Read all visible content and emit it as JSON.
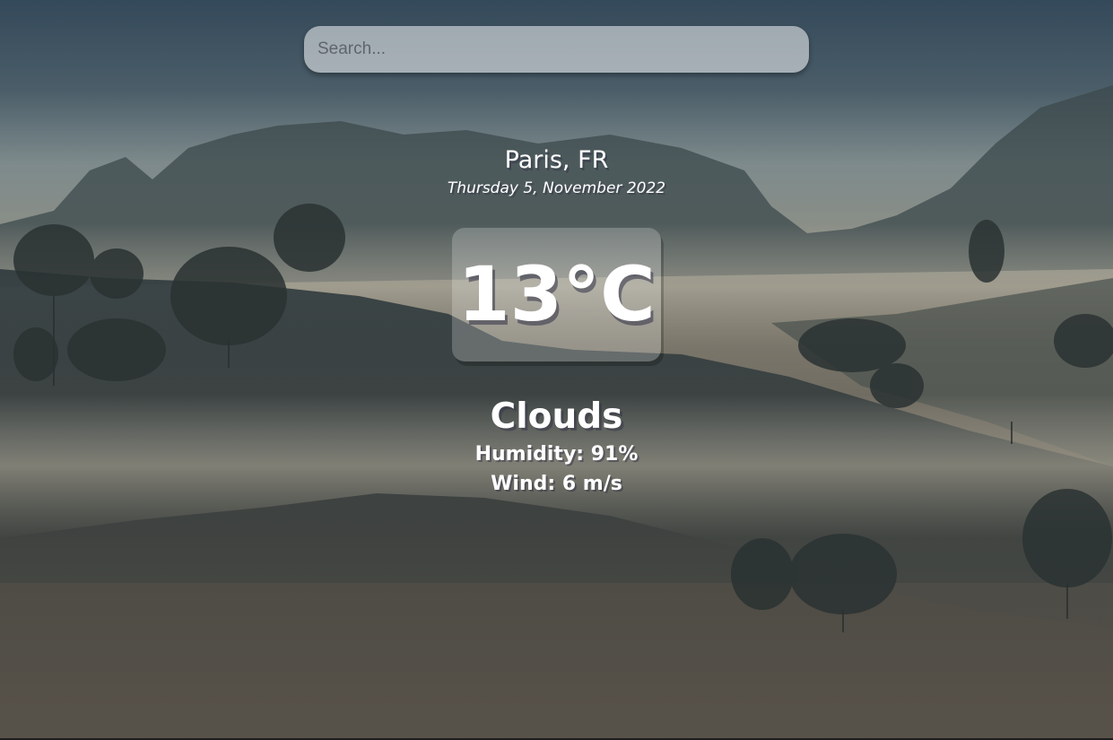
{
  "search": {
    "placeholder": "Search...",
    "value": ""
  },
  "location": {
    "city": "Paris, FR",
    "date": "Thursday 5, November 2022"
  },
  "temperature": {
    "display": "13°C"
  },
  "weather": {
    "condition": "Clouds",
    "humidity": "Humidity: 91%",
    "wind": "Wind: 6 m/s"
  },
  "colors": {
    "text": "#ffffff",
    "search_bg": "rgba(255,255,255,0.52)",
    "panel_bg": "rgba(255,255,255,0.22)"
  }
}
